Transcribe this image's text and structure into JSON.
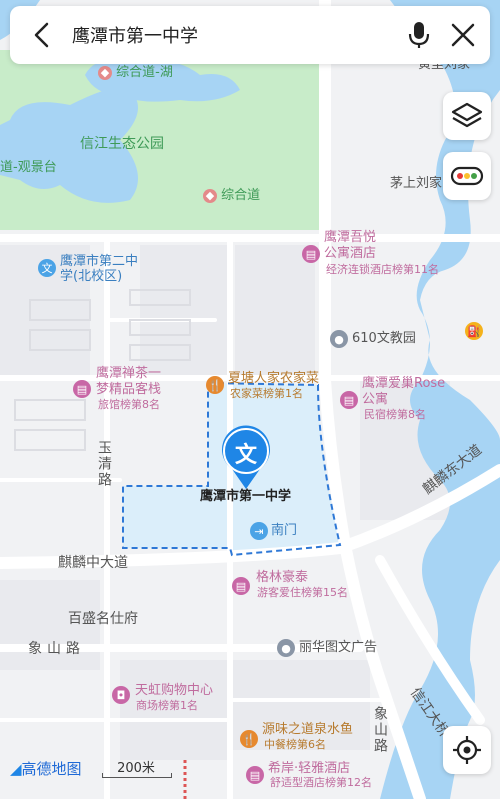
{
  "search": {
    "query": "鹰潭市第一中学"
  },
  "colors": {
    "park": "#c8ecc9",
    "water": "#a7d4f4",
    "highlight": "#dbeefa",
    "dash": "#2e78d6",
    "road": "#ffffff",
    "blue": "#1f86e6"
  },
  "map": {
    "park_labels": [
      {
        "text": "综合道-湖"
      },
      {
        "text": "信江生态公园"
      },
      {
        "text": "道-观景台"
      },
      {
        "text": "综合道"
      }
    ],
    "top_right": [
      {
        "text": "黄里刘家"
      },
      {
        "text": "茅上刘家"
      }
    ],
    "pois": [
      {
        "name": "鹰潭市第二中学(北校区)",
        "line1": "鹰潭市第二中",
        "line2": "学(北校区)"
      },
      {
        "name": "鹰潭吾悦公寓酒店",
        "line1": "鹰潭吾悦",
        "line2": "公寓酒店",
        "rank": "经济连锁酒店榜第11名"
      },
      {
        "name": "610文教园",
        "line1": "610文教园"
      },
      {
        "name": "鹰潭禅茶一梦精品客栈",
        "line1": "鹰潭禅茶一",
        "line2": "梦精品客栈",
        "rank": "旅馆榜第8名"
      },
      {
        "name": "夏塘人家农家菜",
        "line1": "夏塘人家农家菜",
        "rank": "农家菜榜第1名"
      },
      {
        "name": "鹰潭爱巢Rose公寓",
        "line1": "鹰潭爱巢Rose",
        "line2": "公寓",
        "rank": "民宿榜第8名"
      },
      {
        "name": "格林豪泰",
        "line1": "格林豪泰",
        "rank": "游客爱住榜第15名"
      },
      {
        "name": "百盛名仕府",
        "line1": "百盛名仕府"
      },
      {
        "name": "丽华图文广告",
        "line1": "丽华图文广告"
      },
      {
        "name": "天虹购物中心",
        "line1": "天虹购物中心",
        "rank": "商场榜第1名"
      },
      {
        "name": "源味之道泉水鱼",
        "line1": "源味之道泉水鱼",
        "rank": "中餐榜第6名"
      },
      {
        "name": "希岸·轻雅酒店",
        "line1": "希岸·轻雅酒店",
        "rank": "舒适型酒店榜第12名"
      }
    ],
    "school": {
      "name": "鹰潭市第一中学",
      "pin_glyph": "文",
      "gate": "南门"
    },
    "roads": [
      {
        "text": "玉清路"
      },
      {
        "text": "麒麟中大道"
      },
      {
        "text": "麒麟东大道"
      },
      {
        "text": "象山路"
      },
      {
        "text": "象山路"
      },
      {
        "text": "信江大桥"
      }
    ],
    "logo": "高德地图",
    "scale": "200米"
  }
}
